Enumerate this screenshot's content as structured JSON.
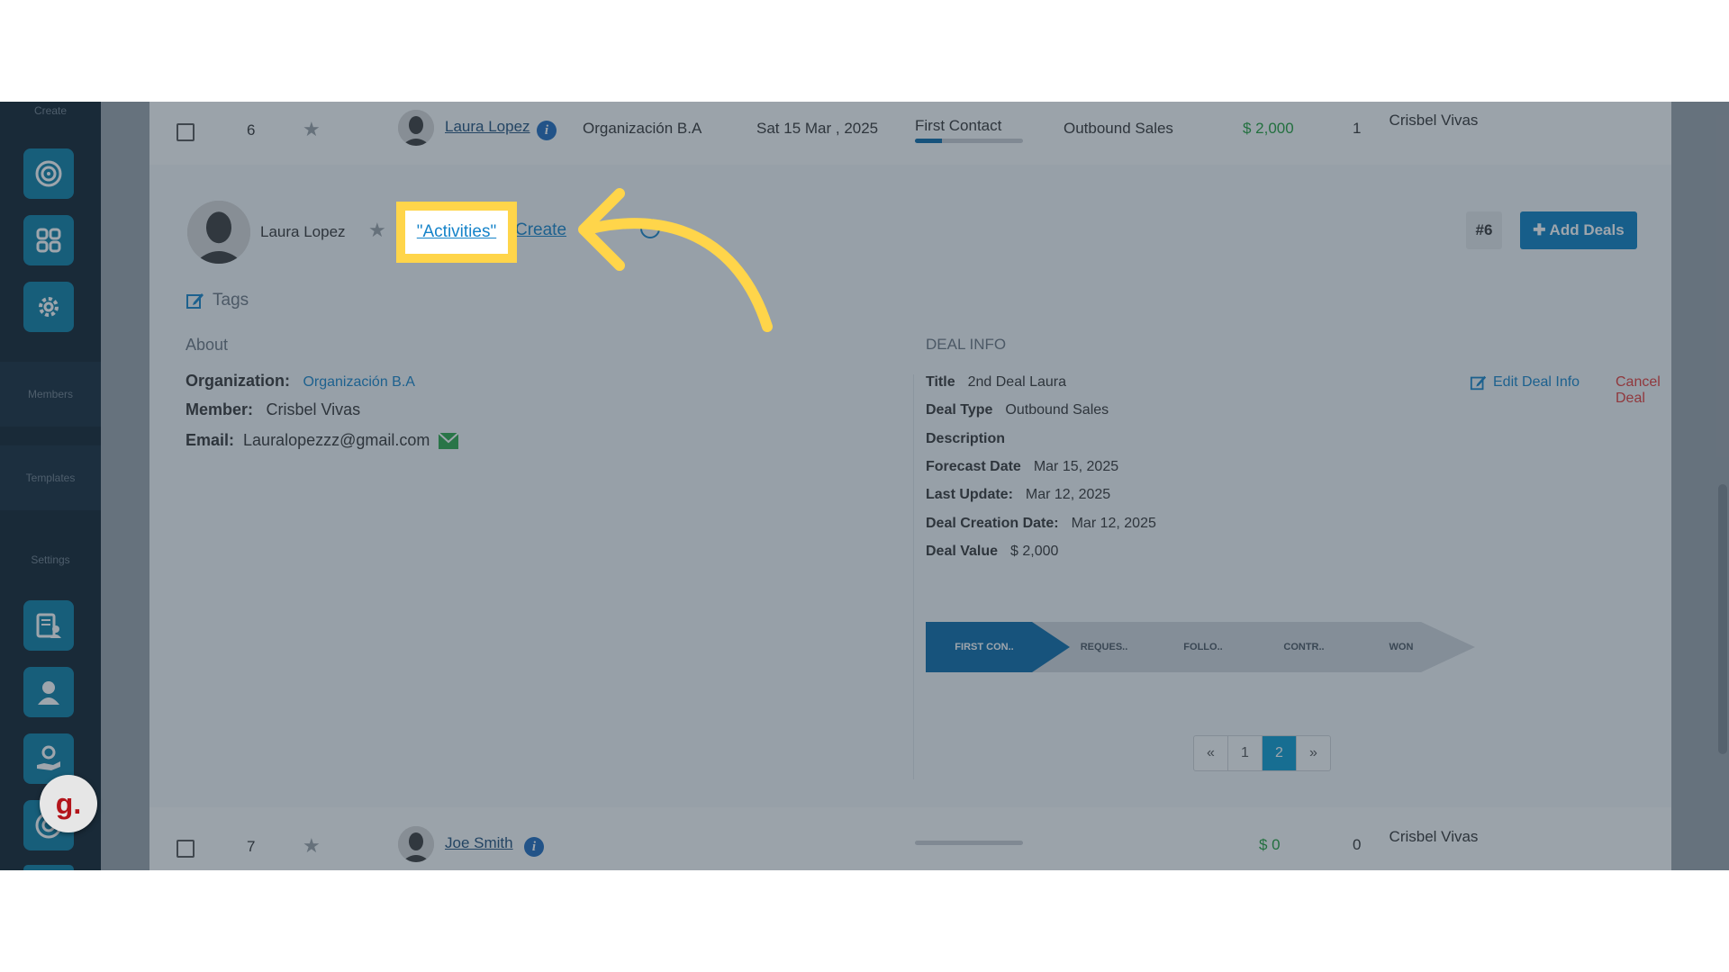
{
  "sidebar": {
    "create_label": "Create",
    "members_label": "Members",
    "templates_label": "Templates",
    "settings_label": "Settings",
    "badge_letter": "g."
  },
  "rows": [
    {
      "index": "6",
      "contact_name": "Laura Lopez",
      "organization": "Organización B.A",
      "date": "Sat 15 Mar , 2025",
      "stage": "First Contact",
      "stage_progress": 0.25,
      "deal_type": "Outbound Sales",
      "value": "$ 2,000",
      "count": "1",
      "member": "Crisbel Vivas"
    },
    {
      "index": "7",
      "contact_name": "Joe Smith",
      "organization": "",
      "date": "",
      "stage": "",
      "stage_progress": 0,
      "deal_type": "",
      "value": "$ 0",
      "count": "0",
      "member": "Crisbel Vivas"
    }
  ],
  "detail": {
    "contact_name": "Laura Lopez",
    "activities_label": "\"Activities\"",
    "create_label": "Create",
    "deal_number": "#6",
    "add_deals_label": "Add Deals",
    "tags_label": "Tags",
    "about": {
      "heading": "About",
      "organization_label": "Organization:",
      "organization_value": "Organización B.A",
      "member_label": "Member:",
      "member_value": "Crisbel Vivas",
      "email_label": "Email:",
      "email_value": "Lauralopezzz@gmail.com"
    },
    "deal_info": {
      "heading": "DEAL INFO",
      "edit_label": "Edit Deal Info",
      "cancel_label": "Cancel Deal",
      "title_label": "Title",
      "title_value": "2nd Deal Laura",
      "type_label": "Deal Type",
      "type_value": "Outbound Sales",
      "description_label": "Description",
      "forecast_label": "Forecast Date",
      "forecast_value": "Mar 15, 2025",
      "last_update_label": "Last Update:",
      "last_update_value": "Mar 12, 2025",
      "creation_label": "Deal Creation Date:",
      "creation_value": "Mar 12, 2025",
      "value_label": "Deal Value",
      "value_value": "$ 2,000"
    },
    "pipeline": [
      "FIRST CON..",
      "REQUES..",
      "FOLLO..",
      "CONTR..",
      "WON"
    ],
    "pager": {
      "prev": "«",
      "pages": [
        "1",
        "2"
      ],
      "active": "2",
      "next": "»"
    }
  },
  "colors": {
    "sidebar_bg": "#0e1f2d",
    "accent": "#0a7fc2",
    "green": "#1f9e3a",
    "cancel_red": "#e53935",
    "highlight_yellow": "#ffd54a"
  }
}
